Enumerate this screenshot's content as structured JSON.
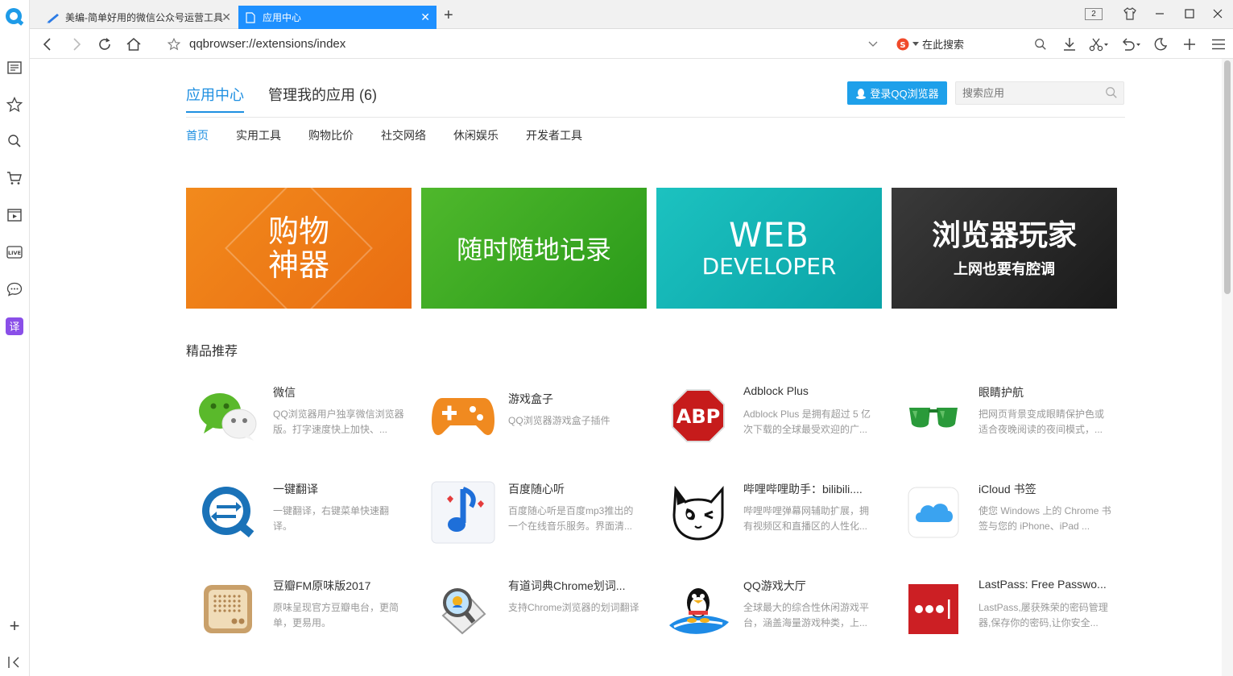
{
  "tabs": [
    {
      "title": "美编-简单好用的微信公众号运营工具"
    },
    {
      "title": "应用中心"
    }
  ],
  "tab_count": "2",
  "toolbar": {
    "url": "qqbrowser://extensions/index",
    "search_placeholder": "在此搜索"
  },
  "header": {
    "main_tabs": [
      "应用中心",
      "管理我的应用 (6)"
    ],
    "login_label": "登录QQ浏览器",
    "search_placeholder": "搜索应用"
  },
  "categories": [
    "首页",
    "实用工具",
    "购物比价",
    "社交网络",
    "休闲娱乐",
    "开发者工具"
  ],
  "banners": {
    "shopping": [
      "购物",
      "神器"
    ],
    "notes": "随时随地记录",
    "web": [
      "WEB",
      "DEVELOPER"
    ],
    "player": [
      "浏览器玩家",
      "上网也要有腔调"
    ]
  },
  "section_title": "精品推荐",
  "apps": [
    {
      "name": "微信",
      "desc": "QQ浏览器用户独享微信浏览器版。打字速度快上加快、..."
    },
    {
      "name": "游戏盒子",
      "desc": "QQ浏览器游戏盒子插件"
    },
    {
      "name": "Adblock Plus",
      "desc": "Adblock Plus 是拥有超过 5 亿次下载的全球最受欢迎的广..."
    },
    {
      "name": "眼睛护航",
      "desc": "把网页背景变成眼睛保护色或适合夜晚阅读的夜间模式，..."
    },
    {
      "name": "一键翻译",
      "desc": "一键翻译，右键菜单快速翻译。"
    },
    {
      "name": "百度随心听",
      "desc": "百度随心听是百度mp3推出的一个在线音乐服务。界面清..."
    },
    {
      "name": "哔哩哔哩助手：bilibili....",
      "desc": "哔哩哔哩弹幕网辅助扩展，拥有视频区和直播区的人性化..."
    },
    {
      "name": "iCloud 书签",
      "desc": "使您 Windows 上的 Chrome 书签与您的 iPhone、iPad ..."
    },
    {
      "name": "豆瓣FM原味版2017",
      "desc": "原味呈现官方豆瓣电台，更简单，更易用。"
    },
    {
      "name": "有道词典Chrome划词...",
      "desc": "支持Chrome浏览器的划词翻译"
    },
    {
      "name": "QQ游戏大厅",
      "desc": "全球最大的综合性休闲游戏平台，涵盖海量游戏种类，上..."
    },
    {
      "name": "LastPass: Free Passwo...",
      "desc": "LastPass,屡获殊荣的密码管理器,保存你的密码,让你安全..."
    }
  ],
  "icons": {
    "abp_text": "ABP"
  },
  "colors": {
    "accent": "#1e8fe1",
    "login_button": "#1ea0ea",
    "active_tab": "#1e90ff"
  }
}
